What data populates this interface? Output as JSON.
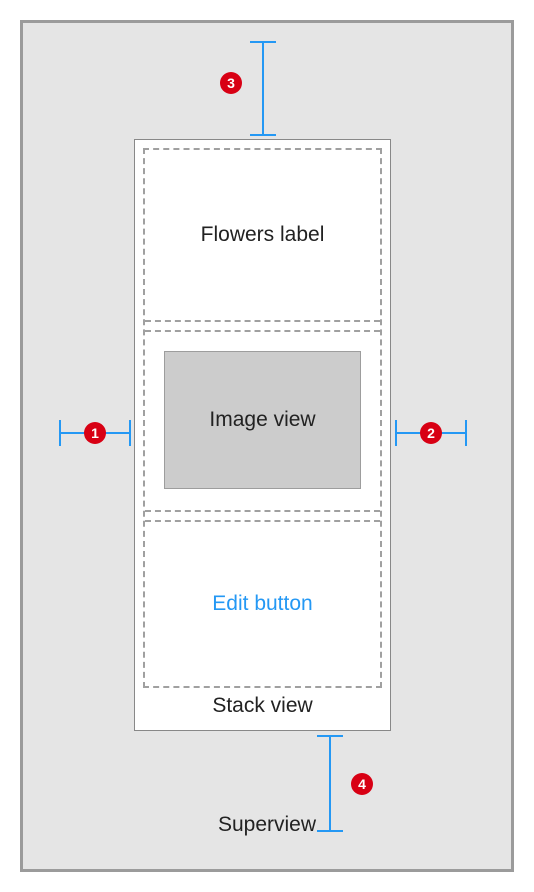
{
  "superview": {
    "label": "Superview"
  },
  "stackview": {
    "label": "Stack view",
    "cells": {
      "flowers_label": "Flowers label",
      "image_view": "Image view",
      "edit_button": "Edit button"
    }
  },
  "constraints": {
    "leading": {
      "number": "1"
    },
    "trailing": {
      "number": "2"
    },
    "top": {
      "number": "3"
    },
    "bottom": {
      "number": "4"
    }
  },
  "colors": {
    "accent_blue": "#2498f4",
    "badge_red": "#d80014",
    "panel_bg": "#e5e5e5"
  }
}
